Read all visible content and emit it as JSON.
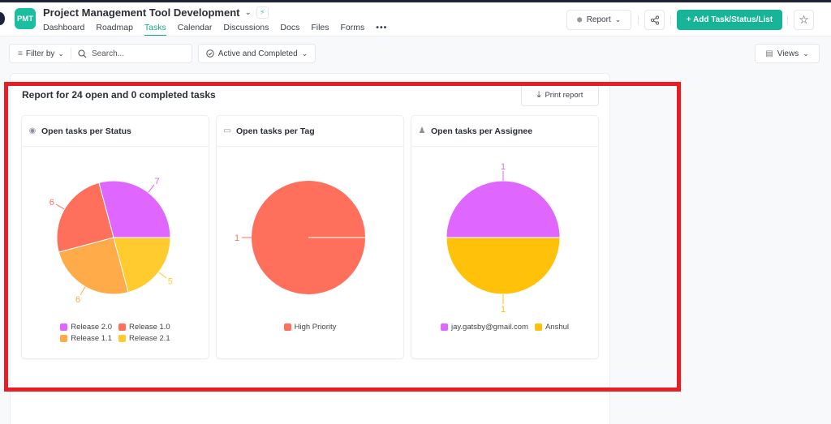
{
  "header": {
    "logo": "PMT",
    "project_title": "Project Management Tool Development",
    "nav": [
      "Dashboard",
      "Roadmap",
      "Tasks",
      "Calendar",
      "Discussions",
      "Docs",
      "Files",
      "Forms"
    ],
    "active_nav": "Tasks",
    "more_label": "•••",
    "report_label": "Report",
    "add_label": "+ Add Task/Status/List",
    "colors": {
      "brand": "#17b597"
    }
  },
  "toolbar": {
    "filter_label": "Filter by",
    "search_placeholder": "Search...",
    "status_filter": "Active and Completed",
    "views_label": "Views"
  },
  "report": {
    "title": "Report for 24 open and 0 completed tasks",
    "print_label": "Print report"
  },
  "chart_data": [
    {
      "type": "pie",
      "title": "Open tasks per Status",
      "icon": "status-icon",
      "categories": [
        "Release 2.0",
        "Release 1.0",
        "Release 1.1",
        "Release 2.1"
      ],
      "values": [
        7,
        6,
        6,
        5
      ],
      "colors": [
        "#df66ff",
        "#ff705c",
        "#ffab4a",
        "#ffcb2f"
      ],
      "labels_shown": true,
      "legend": "bottom"
    },
    {
      "type": "pie",
      "title": "Open tasks per Tag",
      "icon": "tag-icon",
      "categories": [
        "High Priority"
      ],
      "values": [
        1
      ],
      "colors": [
        "#ff705c"
      ],
      "labels_shown": true,
      "legend": "bottom"
    },
    {
      "type": "pie",
      "title": "Open tasks per Assignee",
      "icon": "user-icon",
      "categories": [
        "jay.gatsby@gmail.com",
        "Anshul"
      ],
      "values": [
        1,
        1
      ],
      "colors": [
        "#df66ff",
        "#ffc10a"
      ],
      "labels_shown": true,
      "legend": "bottom"
    }
  ]
}
